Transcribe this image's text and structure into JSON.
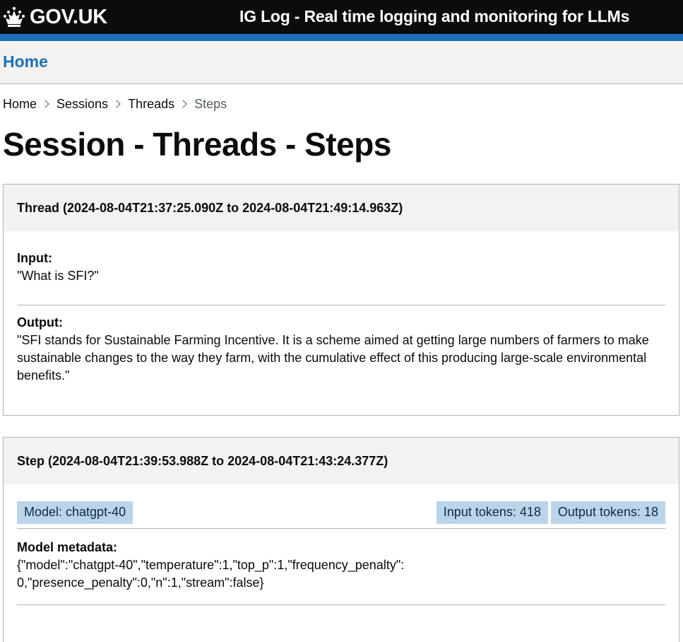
{
  "header": {
    "logo_text": "GOV.UK",
    "service_name": "IG Log - Real time logging and monitoring for LLMs"
  },
  "service_nav": {
    "home_label": "Home"
  },
  "breadcrumbs": [
    "Home",
    "Sessions",
    "Threads",
    "Steps"
  ],
  "page_title": "Session - Threads - Steps",
  "thread": {
    "heading": "Thread (2024-08-04T21:37:25.090Z to 2024-08-04T21:49:14.963Z)",
    "input_label": "Input:",
    "input_value": "\"What is SFI?\"",
    "output_label": "Output:",
    "output_value": "\"SFI stands for Sustainable Farming Incentive. It is a scheme aimed at getting large numbers of farmers to make sustainable changes to the way they farm, with the cumulative effect of this producing large-scale environmental benefits.\""
  },
  "step": {
    "heading": "Step (2024-08-04T21:39:53.988Z to 2024-08-04T21:43:24.377Z)",
    "model_tag": "Model: chatgpt-40",
    "input_tokens_tag": "Input tokens: 418",
    "output_tokens_tag": "Output tokens: 18",
    "metadata_label": "Model metadata:",
    "metadata_value": "{\"model\":\"chatgpt-40\",\"temperature\":1,\"top_p\":1,\"frequency_penalty\":0,\"presence_penalty\":0,\"n\":1,\"stream\":false}"
  },
  "colors": {
    "header_bg": "#0b0c0c",
    "accent_blue": "#1d70b8",
    "nav_bg": "#f3f2f1",
    "tag_bg": "#bbd4ea"
  },
  "icons": [
    "crown-icon",
    "chevron-right-icon"
  ]
}
